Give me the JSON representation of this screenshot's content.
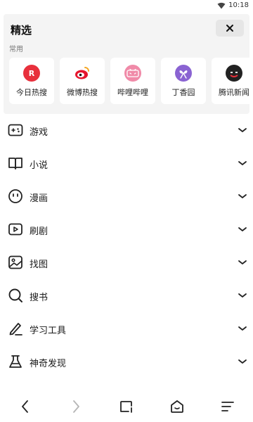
{
  "status_bar": {
    "time": "10:18",
    "wifi_icon": "wifi-icon"
  },
  "panel": {
    "title": "精选",
    "close_icon": "close-icon",
    "section_label": "常用",
    "quick_items": [
      {
        "label": "今日热搜",
        "icon": "today-hot-search-icon",
        "color": "#e8303c"
      },
      {
        "label": "微博热搜",
        "icon": "weibo-icon",
        "color": "#f5a623"
      },
      {
        "label": "哔哩哔哩",
        "icon": "bilibili-icon",
        "color": "#f08aa8"
      },
      {
        "label": "丁香园",
        "icon": "dingxiangyuan-icon",
        "color": "#8a63d2"
      },
      {
        "label": "腾讯新闻",
        "icon": "tencent-news-icon",
        "color": "#222222"
      }
    ]
  },
  "categories": [
    {
      "label": "游戏",
      "icon": "gamepad-icon"
    },
    {
      "label": "小说",
      "icon": "book-icon"
    },
    {
      "label": "漫画",
      "icon": "face-icon"
    },
    {
      "label": "刷剧",
      "icon": "play-icon"
    },
    {
      "label": "找图",
      "icon": "image-icon"
    },
    {
      "label": "搜书",
      "icon": "search-icon"
    },
    {
      "label": "学习工具",
      "icon": "pen-icon"
    },
    {
      "label": "神奇发现",
      "icon": "flask-icon"
    }
  ],
  "bottom_nav": [
    {
      "name": "back",
      "icon": "back-icon"
    },
    {
      "name": "forward",
      "icon": "forward-icon"
    },
    {
      "name": "tabs",
      "icon": "tabs-icon"
    },
    {
      "name": "home",
      "icon": "home-icon"
    },
    {
      "name": "menu",
      "icon": "menu-icon"
    }
  ]
}
